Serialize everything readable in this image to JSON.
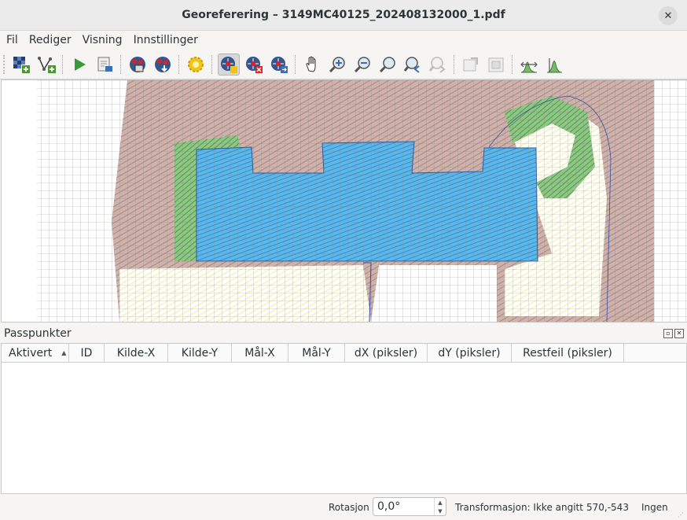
{
  "window": {
    "title": "Georeferering – 3149MC40125_202408132000_1.pdf"
  },
  "menu": [
    "Fil",
    "Rediger",
    "Visning",
    "Innstillinger"
  ],
  "toolbar": [
    {
      "name": "open-raster-icon"
    },
    {
      "name": "start-georeferencing-icon"
    },
    {
      "name": "generate-gdal-script-icon"
    },
    {
      "name": "load-gcp-points-icon"
    },
    {
      "name": "save-gcp-points-icon"
    },
    {
      "name": "transformation-settings-icon"
    },
    {
      "name": "add-point-icon"
    },
    {
      "name": "delete-point-icon"
    },
    {
      "name": "move-gcp-point-icon"
    },
    {
      "name": "pan-icon"
    },
    {
      "name": "zoom-in-icon"
    },
    {
      "name": "zoom-out-icon"
    },
    {
      "name": "zoom-to-layer-icon"
    },
    {
      "name": "zoom-last-icon"
    },
    {
      "name": "zoom-next-icon"
    },
    {
      "name": "link-georeferencer-icon"
    },
    {
      "name": "link-qgis-icon"
    },
    {
      "name": "full-histogram-stretch-icon"
    },
    {
      "name": "local-histogram-stretch-icon"
    }
  ],
  "dock": {
    "title": "Passpunkter"
  },
  "table": {
    "columns": [
      "Aktivert",
      "ID",
      "Kilde-X",
      "Kilde-Y",
      "Mål-X",
      "Mål-Y",
      "dX (piksler)",
      "dY (piksler)",
      "Restfeil (piksler)"
    ],
    "sort_indicator": "▲",
    "rows": []
  },
  "status": {
    "rotation_label": "Rotasjon",
    "rotation_value": "0,0°",
    "transformation": "Transformasjon: Ikke angitt",
    "coordinates": "570,-543",
    "crs": "Ingen"
  }
}
